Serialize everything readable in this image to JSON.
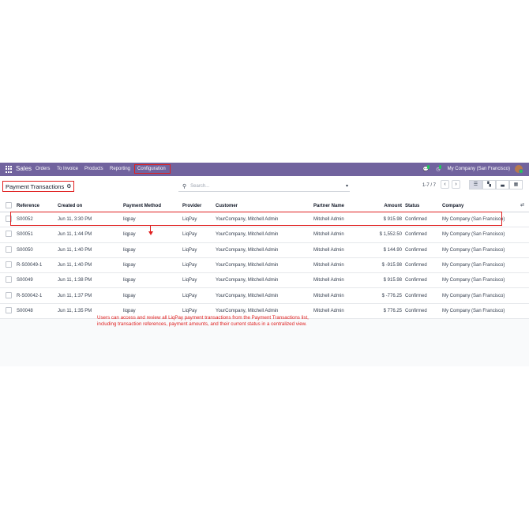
{
  "navbar": {
    "brand": "Sales",
    "menu": [
      "Orders",
      "To Invoice",
      "Products",
      "Reporting",
      "Configuration"
    ],
    "company": "My Company (San Francisco)",
    "messages_badge": "",
    "activity_badge": ""
  },
  "control": {
    "title": "Payment Transactions",
    "search_placeholder": "Search...",
    "pager": "1-7 / 7"
  },
  "table": {
    "headers": [
      "Reference",
      "Created on",
      "Payment Method",
      "Provider",
      "Customer",
      "Partner Name",
      "Amount",
      "Status",
      "Company"
    ],
    "rows": [
      [
        "S00052",
        "Jun 11, 3:30 PM",
        "liqpay",
        "LiqPay",
        "YourCompany, Mitchell Admin",
        "Mitchell Admin",
        "$ 915.98",
        "Confirmed",
        "My Company (San Francisco)"
      ],
      [
        "S00051",
        "Jun 11, 1:44 PM",
        "liqpay",
        "LiqPay",
        "YourCompany, Mitchell Admin",
        "Mitchell Admin",
        "$ 1,552.50",
        "Confirmed",
        "My Company (San Francisco)"
      ],
      [
        "S00050",
        "Jun 11, 1:40 PM",
        "liqpay",
        "LiqPay",
        "YourCompany, Mitchell Admin",
        "Mitchell Admin",
        "$ 144.90",
        "Confirmed",
        "My Company (San Francisco)"
      ],
      [
        "R-S00049-1",
        "Jun 11, 1:40 PM",
        "liqpay",
        "LiqPay",
        "YourCompany, Mitchell Admin",
        "Mitchell Admin",
        "$ -915.98",
        "Confirmed",
        "My Company (San Francisco)"
      ],
      [
        "S00049",
        "Jun 11, 1:38 PM",
        "liqpay",
        "LiqPay",
        "YourCompany, Mitchell Admin",
        "Mitchell Admin",
        "$ 915.98",
        "Confirmed",
        "My Company (San Francisco)"
      ],
      [
        "R-S00042-1",
        "Jun 11, 1:37 PM",
        "liqpay",
        "LiqPay",
        "YourCompany, Mitchell Admin",
        "Mitchell Admin",
        "$ -776.25",
        "Confirmed",
        "My Company (San Francisco)"
      ],
      [
        "S00048",
        "Jun 11, 1:35 PM",
        "liqpay",
        "LiqPay",
        "YourCompany, Mitchell Admin",
        "Mitchell Admin",
        "$ 776.25",
        "Confirmed",
        "My Company (San Francisco)"
      ]
    ]
  },
  "caption": {
    "line1": "Users can access and review all LiqPay payment transactions from the Payment Transactions list,",
    "line2": "including transaction references, payment amounts, and their current status in a centralized view."
  },
  "colors": {
    "navbar": "#71639e",
    "annotation": "#e02020"
  },
  "icons": [
    "apps-icon",
    "chat-icon",
    "clock-icon",
    "gear-icon",
    "search-icon",
    "chevron-left-icon",
    "chevron-right-icon",
    "list-view-icon",
    "kanban-view-icon",
    "graph-view-icon",
    "pivot-view-icon",
    "optional-columns-icon"
  ]
}
